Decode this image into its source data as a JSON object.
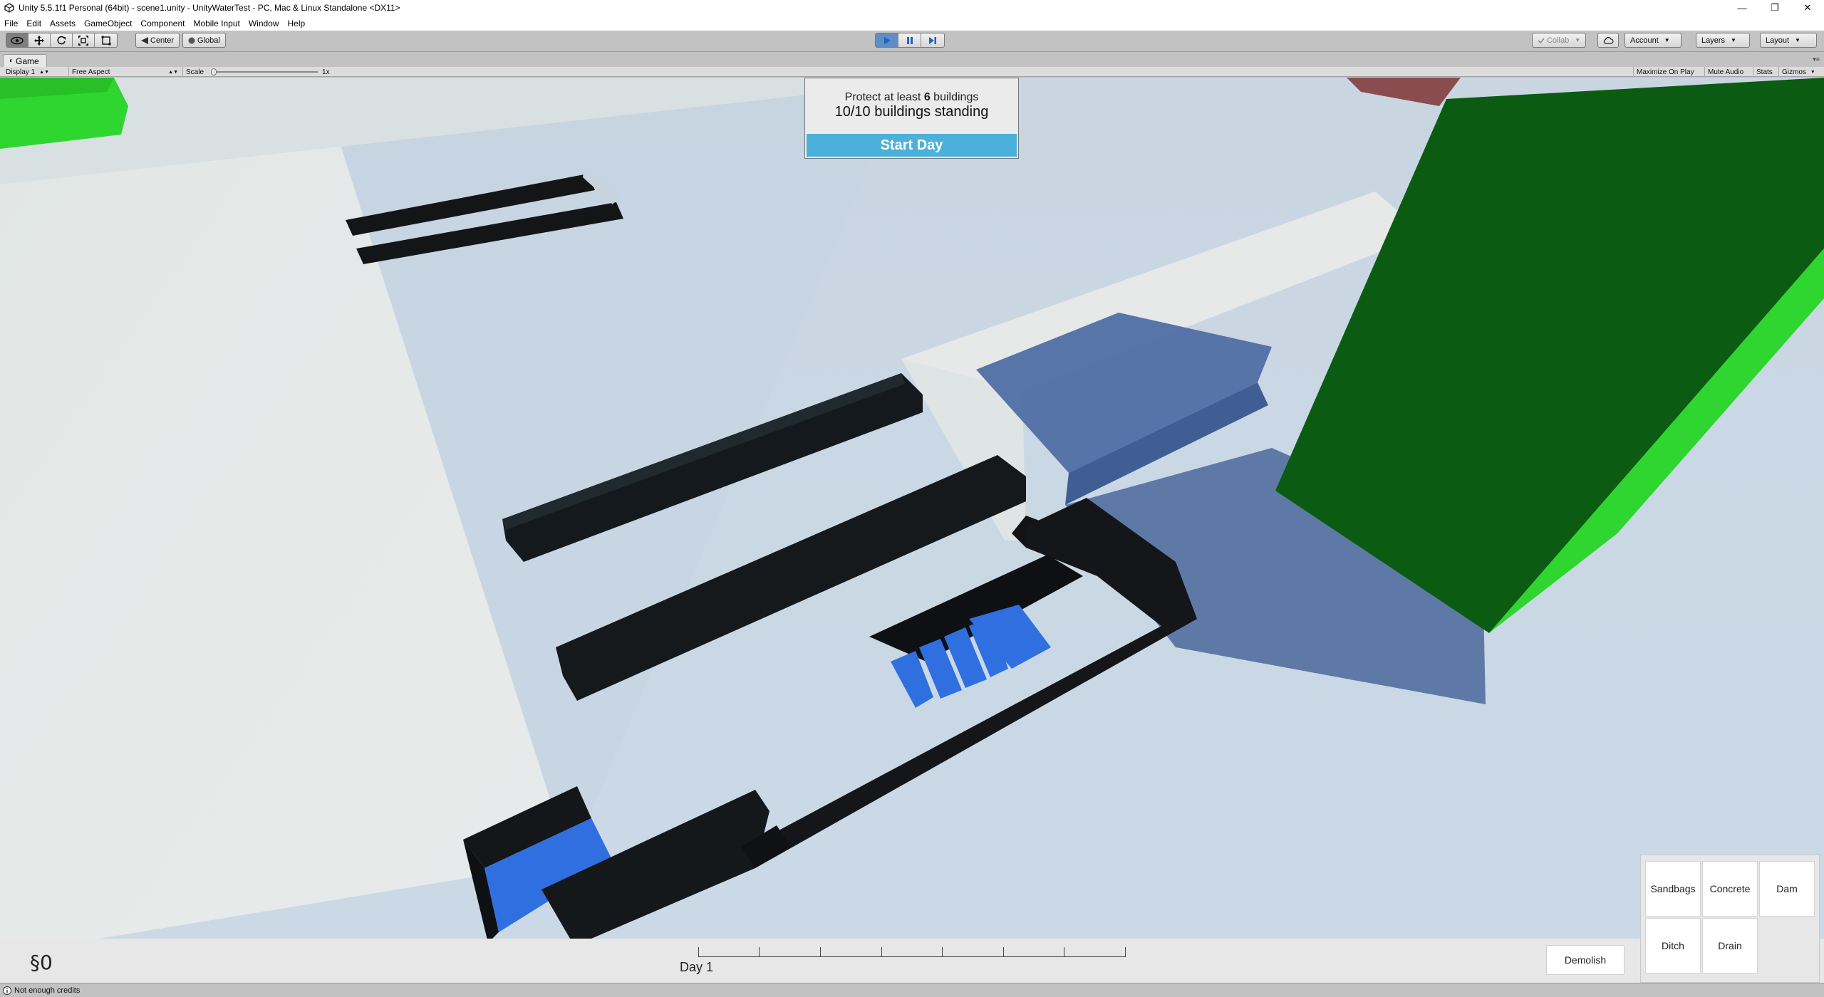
{
  "window": {
    "title": "Unity 5.5.1f1 Personal (64bit) - scene1.unity - UnityWaterTest - PC, Mac & Linux Standalone <DX11>",
    "controls": [
      "—",
      "❐",
      "✕"
    ]
  },
  "menu": [
    "File",
    "Edit",
    "Assets",
    "GameObject",
    "Component",
    "Mobile Input",
    "Window",
    "Help"
  ],
  "toolbar": {
    "tools": [
      "hand-tool",
      "move-tool",
      "rotate-tool",
      "scale-tool",
      "rect-tool"
    ],
    "pivot_label": "Center",
    "space_label": "Global",
    "collab_label": "Collab",
    "account_label": "Account",
    "layers_label": "Layers",
    "layout_label": "Layout"
  },
  "game_view": {
    "tab_label": "Game",
    "display_label": "Display 1",
    "aspect_label": "Free Aspect",
    "scale_label": "Scale",
    "scale_value": "1x",
    "maximize_label": "Maximize On Play",
    "mute_label": "Mute Audio",
    "stats_label": "Stats",
    "gizmos_label": "Gizmos"
  },
  "hud": {
    "objective_prefix": "Protect at least ",
    "objective_count": "6",
    "objective_suffix": " buildings",
    "standing": "10/10 buildings standing",
    "start_day": "Start Day",
    "credits": "§0",
    "day_label": "Day 1",
    "day_progress": 0,
    "demolish": "Demolish",
    "build_options": [
      "Sandbags",
      "Concrete",
      "Dam",
      "Ditch",
      "Drain"
    ]
  },
  "status": {
    "message": "Not enough credits"
  },
  "colors": {
    "water": "#2f6fe0",
    "wall": "#131517",
    "building": "#0b5c12",
    "building_edge": "#2fd62f",
    "ground": "#dfe6e8",
    "accent_button": "#4bb1da",
    "play_active": "#5f8ec4"
  }
}
